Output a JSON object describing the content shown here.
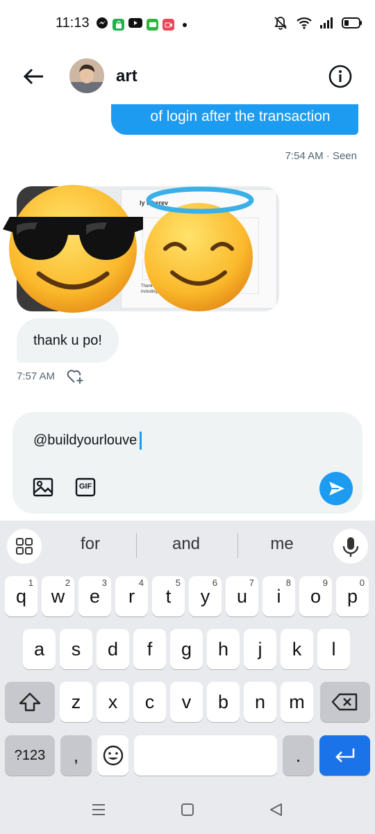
{
  "status_bar": {
    "time": "11:13",
    "app_icons": [
      "messenger-icon",
      "shopping-bag-icon",
      "youtube-icon",
      "chat-icon",
      "recorder-icon"
    ],
    "right_icons": [
      "mute-icon",
      "wifi-icon",
      "signal-icon",
      "battery-icon"
    ]
  },
  "header": {
    "name": "art",
    "back_icon": "arrow-left-icon",
    "info_icon": "info-icon"
  },
  "messages": {
    "sent": {
      "text": "of login after the transaction",
      "meta": "7:54 AM · Seen"
    },
    "received_media": {
      "emojis": [
        "smiling-face-with-sunglasses",
        "smiling-face-with-halo"
      ],
      "preview_snippets": [
        "ly wherev",
        "Thank you for",
        "including"
      ]
    },
    "received_text": {
      "text": "thank u po!",
      "time": "7:57 AM"
    }
  },
  "composer": {
    "value": "@buildyourlouve",
    "image_icon": "image-icon",
    "gif_label": "GIF",
    "send_icon": "send-icon"
  },
  "keyboard": {
    "suggestions": [
      "for",
      "and",
      "me"
    ],
    "row1": [
      {
        "k": "q",
        "n": "1"
      },
      {
        "k": "w",
        "n": "2"
      },
      {
        "k": "e",
        "n": "3"
      },
      {
        "k": "r",
        "n": "4"
      },
      {
        "k": "t",
        "n": "5"
      },
      {
        "k": "y",
        "n": "6"
      },
      {
        "k": "u",
        "n": "7"
      },
      {
        "k": "i",
        "n": "8"
      },
      {
        "k": "o",
        "n": "9"
      },
      {
        "k": "p",
        "n": "0"
      }
    ],
    "row2": [
      "a",
      "s",
      "d",
      "f",
      "g",
      "h",
      "j",
      "k",
      "l"
    ],
    "row3": [
      "z",
      "x",
      "c",
      "v",
      "b",
      "n",
      "m"
    ],
    "symbols_label": "?123",
    "comma": ",",
    "period": "."
  },
  "colors": {
    "accent": "#1d9bf0",
    "keyboard_bg": "#e9eaee",
    "enter_key": "#1a73e8"
  }
}
